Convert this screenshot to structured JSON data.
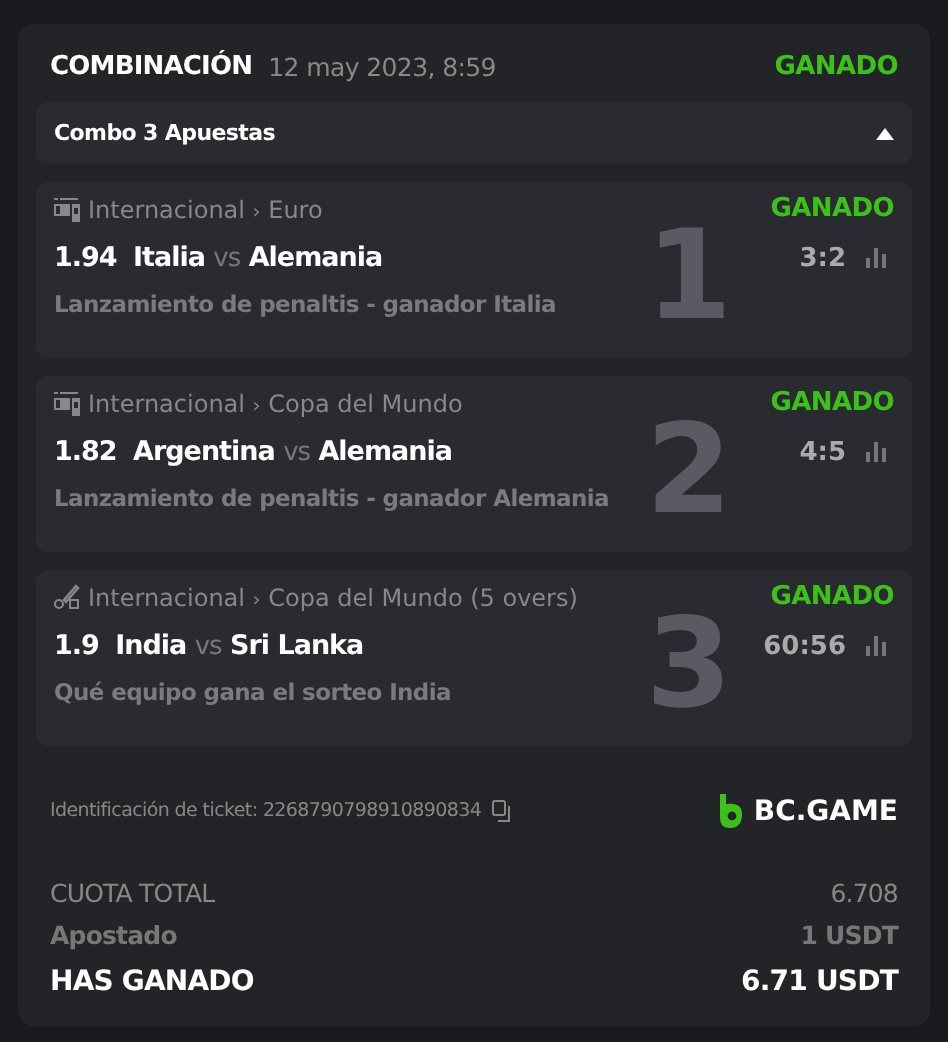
{
  "header": {
    "title": "COMBINACIÓN",
    "date": "12 may 2023, 8:59",
    "status": "GANADO"
  },
  "combo": {
    "label": "Combo 3 Apuestas",
    "expanded": true
  },
  "bets": [
    {
      "kind": "football",
      "league": "Internacional",
      "separator": "›",
      "tournament": "Euro",
      "status": "GANADO",
      "odds": "1.94",
      "home": "Italia",
      "vs": "vs",
      "away": "Alemania",
      "score": "3:2",
      "market": "Lanzamiento de penaltis - ganador Italia",
      "number": "1"
    },
    {
      "kind": "football",
      "league": "Internacional",
      "separator": "›",
      "tournament": "Copa del Mundo",
      "status": "GANADO",
      "odds": "1.82",
      "home": "Argentina",
      "vs": "vs",
      "away": "Alemania",
      "score": "4:5",
      "market": "Lanzamiento de penaltis - ganador Alemania",
      "number": "2"
    },
    {
      "kind": "cricket",
      "league": "Internacional",
      "separator": "›",
      "tournament": "Copa del Mundo (5 overs)",
      "status": "GANADO",
      "odds": "1.9",
      "home": "India",
      "vs": "vs",
      "away": "Sri Lanka",
      "score": "60:56",
      "market": "Qué equipo gana el sorteo India",
      "number": "3"
    }
  ],
  "ticket": {
    "label": "Identificación de ticket: 2268790798910890834",
    "brand": "BC.GAME"
  },
  "totals": [
    {
      "kind": "odds",
      "label": "CUOTA TOTAL",
      "value": "6.708"
    },
    {
      "kind": "stake",
      "label": "Apostado",
      "value": "1 USDT"
    },
    {
      "kind": "win",
      "label": "HAS GANADO",
      "value": "6.71 USDT"
    }
  ]
}
